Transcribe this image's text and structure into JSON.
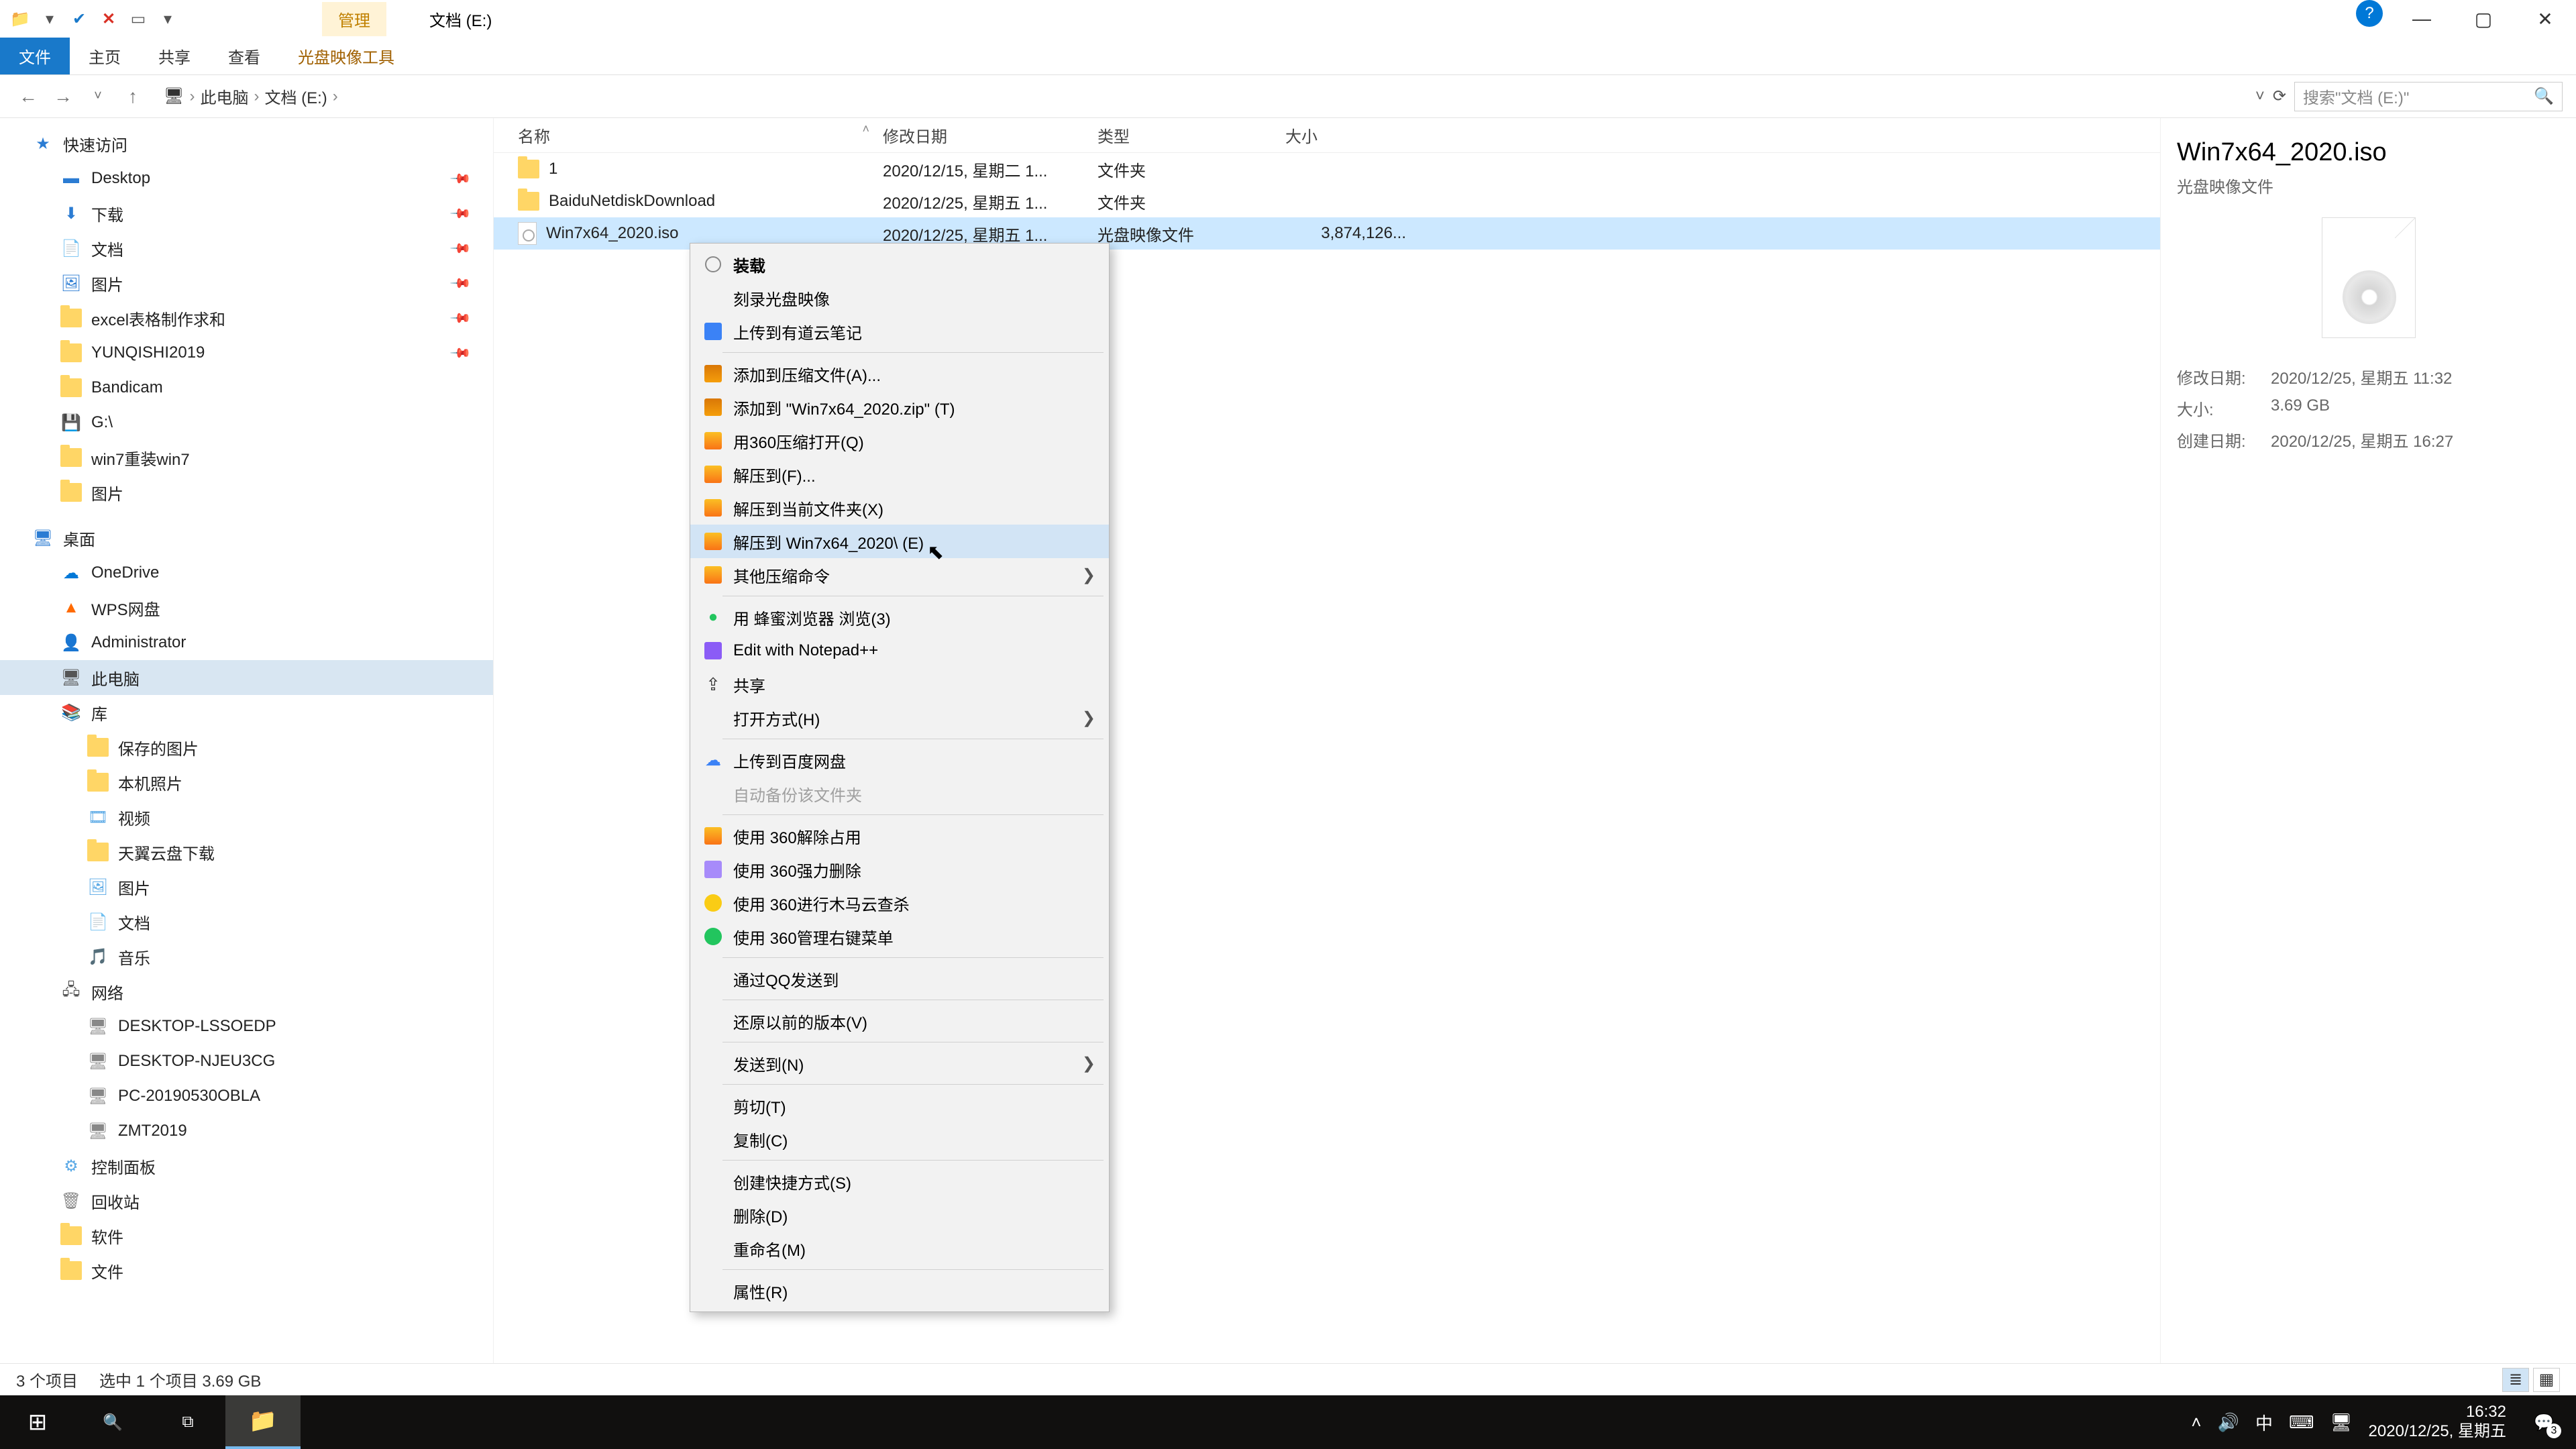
{
  "titlebar": {
    "tab_manage": "管理",
    "tab_location": "文档 (E:)"
  },
  "window_controls": {
    "min": "—",
    "max": "▢",
    "close": "✕",
    "help": "?"
  },
  "ribbon": {
    "file": "文件",
    "home": "主页",
    "share": "共享",
    "view": "查看",
    "tools": "光盘映像工具"
  },
  "addressbar": {
    "back": "←",
    "forward": "→",
    "up": "↑",
    "root": "此电脑",
    "folder": "文档 (E:)",
    "sep": "›",
    "refresh": "⟳",
    "dropdown": "˅",
    "search_placeholder": "搜索\"文档 (E:)\"",
    "search_glyph": "🔍"
  },
  "tree": {
    "quick_access": "快速访问",
    "desktop": "Desktop",
    "downloads": "下载",
    "documents": "文档",
    "pictures": "图片",
    "excel": "excel表格制作求和",
    "yunqishi": "YUNQISHI2019",
    "bandicam": "Bandicam",
    "gdrive": "G:\\",
    "win7": "win7重装win7",
    "pictures2": "图片",
    "desktop2": "桌面",
    "onedrive": "OneDrive",
    "wps": "WPS网盘",
    "admin": "Administrator",
    "thispc": "此电脑",
    "libraries": "库",
    "saved_pics": "保存的图片",
    "camera_roll": "本机照片",
    "videos": "视频",
    "tianyi": "天翼云盘下载",
    "pictures3": "图片",
    "documents2": "文档",
    "music": "音乐",
    "network": "网络",
    "desktop_lssoedp": "DESKTOP-LSSOEDP",
    "desktop_njeu3cg": "DESKTOP-NJEU3CG",
    "pc_2019": "PC-20190530OBLA",
    "zmt2019": "ZMT2019",
    "control_panel": "控制面板",
    "recycle_bin": "回收站",
    "software": "软件",
    "files": "文件"
  },
  "columns": {
    "name": "名称",
    "date": "修改日期",
    "type": "类型",
    "size": "大小",
    "sort_glyph": "˄"
  },
  "files": [
    {
      "name": "1",
      "date": "2020/12/15, 星期二 1...",
      "type": "文件夹",
      "size": "",
      "icon": "folder"
    },
    {
      "name": "BaiduNetdiskDownload",
      "date": "2020/12/25, 星期五 1...",
      "type": "文件夹",
      "size": "",
      "icon": "folder"
    },
    {
      "name": "Win7x64_2020.iso",
      "date": "2020/12/25, 星期五 1...",
      "type": "光盘映像文件",
      "size": "3,874,126...",
      "icon": "iso",
      "selected": true
    }
  ],
  "context_menu": {
    "mount": "装载",
    "burn": "刻录光盘映像",
    "upload_youdao": "上传到有道云笔记",
    "add_archive": "添加到压缩文件(A)...",
    "add_zip": "添加到 \"Win7x64_2020.zip\" (T)",
    "open_360zip": "用360压缩打开(Q)",
    "extract_to": "解压到(F)...",
    "extract_here": "解压到当前文件夹(X)",
    "extract_named": "解压到 Win7x64_2020\\ (E)",
    "other_zip": "其他压缩命令",
    "browse_fm": "用 蜂蜜浏览器 浏览(3)",
    "edit_npp": "Edit with Notepad++",
    "share": "共享",
    "open_with": "打开方式(H)",
    "upload_baidu": "上传到百度网盘",
    "auto_backup": "自动备份该文件夹",
    "unlock_360": "使用 360解除占用",
    "force_delete_360": "使用 360强力删除",
    "trojan_360": "使用 360进行木马云查杀",
    "manage_menu_360": "使用 360管理右键菜单",
    "send_qq": "通过QQ发送到",
    "restore_prev": "还原以前的版本(V)",
    "send_to": "发送到(N)",
    "cut": "剪切(T)",
    "copy": "复制(C)",
    "create_shortcut": "创建快捷方式(S)",
    "delete": "删除(D)",
    "rename": "重命名(M)",
    "properties": "属性(R)",
    "arrow": "❯"
  },
  "details": {
    "title": "Win7x64_2020.iso",
    "subtitle": "光盘映像文件",
    "mod_label": "修改日期:",
    "mod_value": "2020/12/25, 星期五 11:32",
    "size_label": "大小:",
    "size_value": "3.69 GB",
    "created_label": "创建日期:",
    "created_value": "2020/12/25, 星期五 16:27"
  },
  "statusbar": {
    "items": "3 个项目",
    "selected": "选中 1 个项目  3.69 GB"
  },
  "taskbar": {
    "start": "⊞",
    "search": "🔍",
    "taskview": "⧉",
    "explorer": "📁",
    "tray_up": "˄",
    "volume": "🔊",
    "ime": "中",
    "ime2": "⌨",
    "network": "🖥",
    "time": "16:32",
    "date": "2020/12/25, 星期五",
    "notif": "💬",
    "notif_count": "3"
  }
}
